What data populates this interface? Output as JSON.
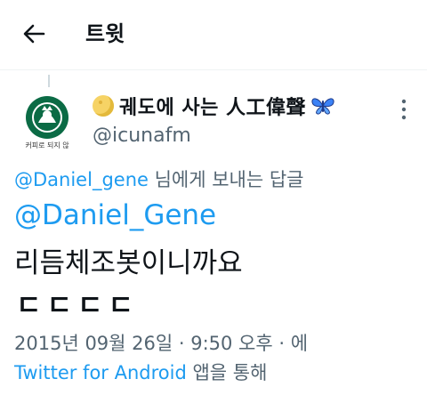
{
  "header": {
    "title": "트윗"
  },
  "tweet": {
    "display_name": "궤도에 사는 人工偉聲",
    "handle": "@icunafm",
    "avatar_caption": "커피로 되지 않",
    "reply_to_handle": "@Daniel_gene",
    "reply_to_suffix": " 님에게 보내는 답글",
    "mention": "@Daniel_Gene",
    "text_line1": "리듬체조봇이니까요",
    "text_line2": "ㄷㄷㄷㄷ",
    "timestamp": "2015년 09월 26일 · 9:50 오후 · 에",
    "client": "Twitter for Android",
    "client_suffix": " 앱을 통해"
  },
  "colors": {
    "accent": "#1d9bf0",
    "secondary_text": "#536471",
    "primary_text": "#0f1419"
  },
  "icons": {
    "back": "arrow-left-icon",
    "more": "more-vertical-icon",
    "moon": "moon-emoji-icon",
    "butterfly": "butterfly-emoji-icon"
  }
}
